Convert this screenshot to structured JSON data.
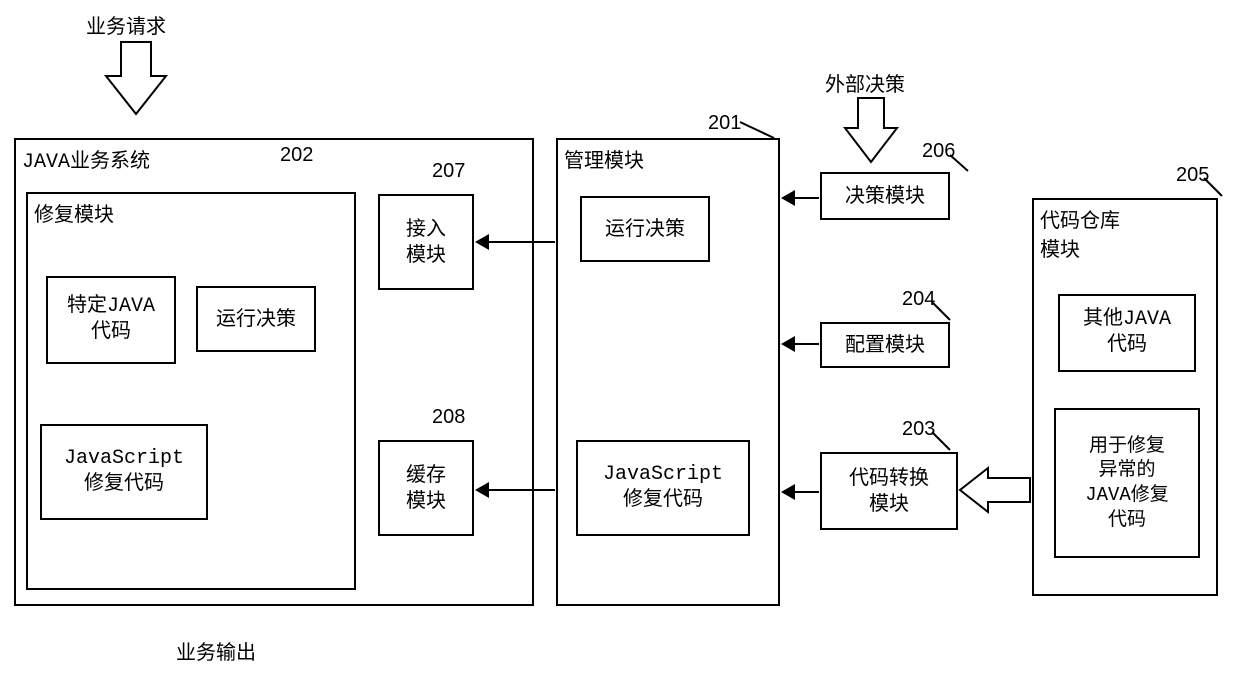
{
  "top": {
    "business_request": "业务请求",
    "external_decision": "外部决策"
  },
  "java_system": {
    "title": "JAVA业务系统",
    "num": "202",
    "repair_module": {
      "title": "修复模块",
      "specific_java_code": "特定JAVA\n代码",
      "run_decision": "运行决策",
      "js_repair_code": "JavaScript\n修复代码"
    },
    "access_module": {
      "num": "207",
      "label": "接入\n模块"
    },
    "cache_module": {
      "num": "208",
      "label": "缓存\n模块"
    }
  },
  "mgmt": {
    "num": "201",
    "title": "管理模块",
    "run_decision": "运行决策",
    "js_repair_code": "JavaScript\n修复代码"
  },
  "decision_module": {
    "num": "206",
    "label": "决策模块"
  },
  "config_module": {
    "num": "204",
    "label": "配置模块"
  },
  "code_convert_module": {
    "num": "203",
    "label": "代码转换\n模块"
  },
  "code_repo": {
    "num": "205",
    "title": "代码仓库\n模块",
    "other_java_code": "其他JAVA\n代码",
    "java_repair_code": "用于修复\n异常的\nJAVA修复\n代码"
  },
  "bottom": {
    "business_output": "业务输出"
  }
}
